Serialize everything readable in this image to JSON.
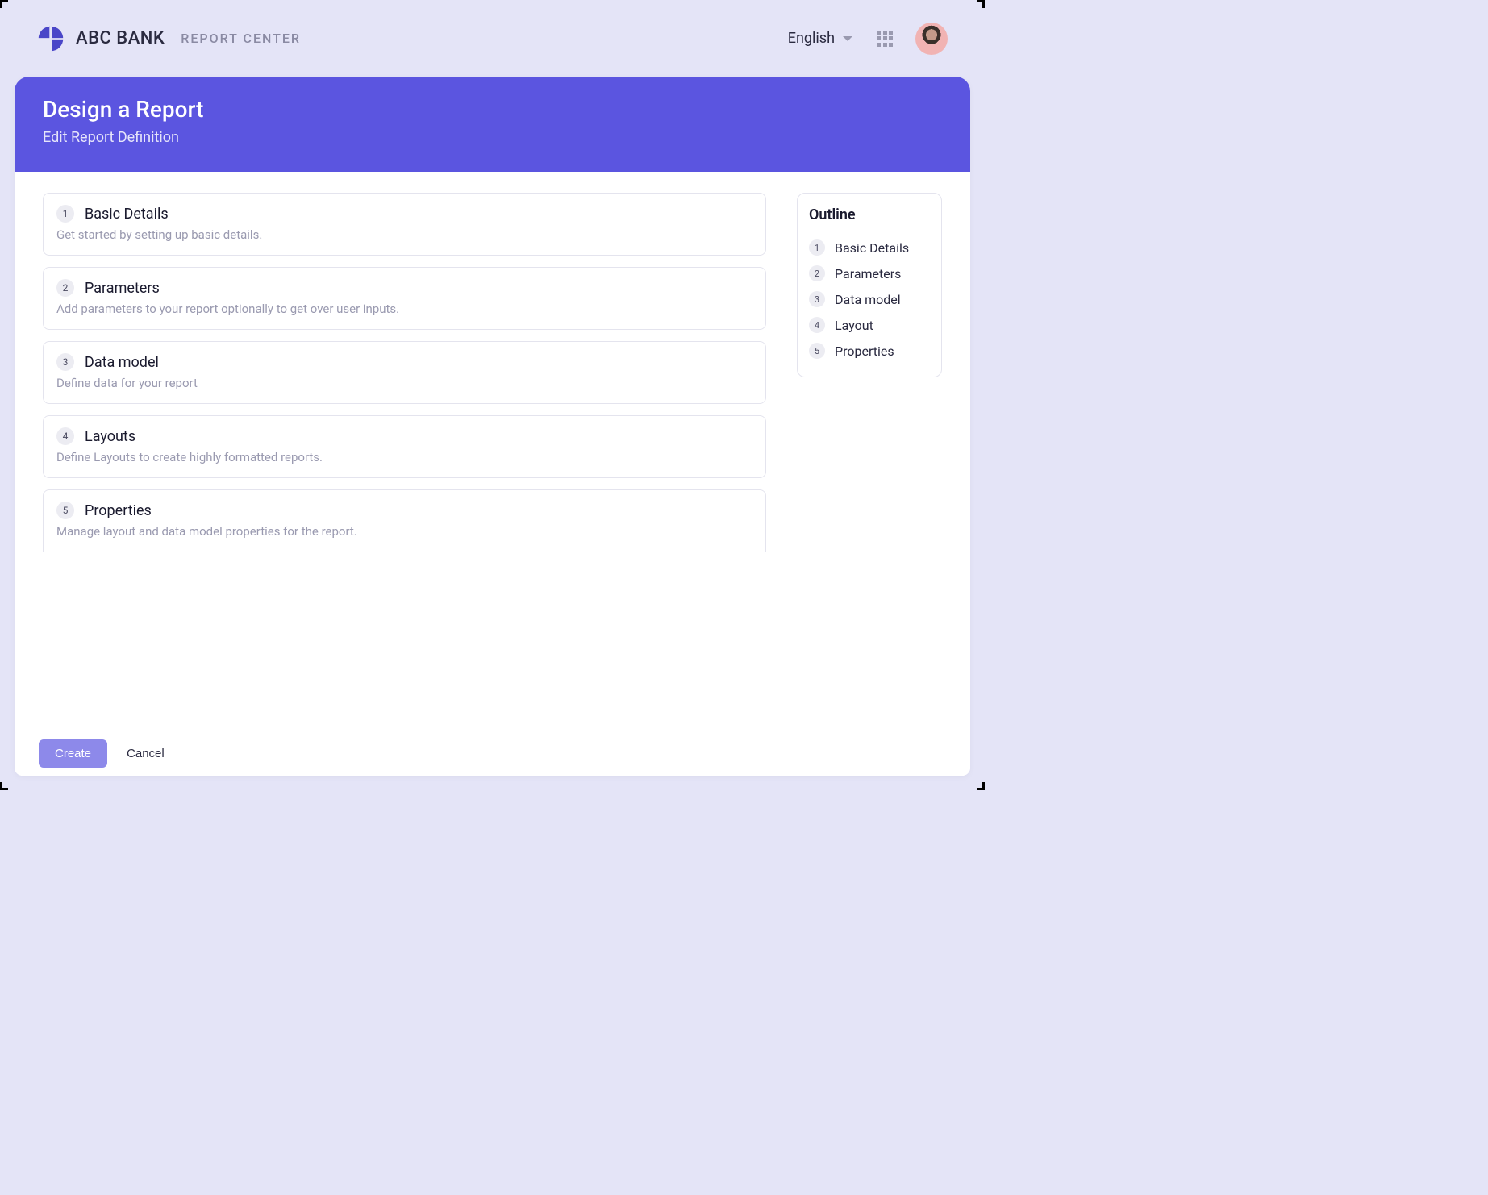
{
  "header": {
    "brand": "ABC BANK",
    "subbrand": "REPORT CENTER",
    "language": "English"
  },
  "hero": {
    "title": "Design a Report",
    "subtitle": "Edit Report Definition"
  },
  "sections": [
    {
      "num": "1",
      "title": "Basic Details",
      "desc": "Get started by setting up basic details."
    },
    {
      "num": "2",
      "title": "Parameters",
      "desc": "Add parameters to your report optionally to get over user inputs."
    },
    {
      "num": "3",
      "title": "Data model",
      "desc": "Define data for your report"
    },
    {
      "num": "4",
      "title": "Layouts",
      "desc": "Define Layouts to create highly formatted reports."
    },
    {
      "num": "5",
      "title": "Properties",
      "desc": "Manage layout and data model properties for the report."
    }
  ],
  "outline": {
    "title": "Outline",
    "items": [
      {
        "num": "1",
        "label": "Basic Details"
      },
      {
        "num": "2",
        "label": "Parameters"
      },
      {
        "num": "3",
        "label": "Data model"
      },
      {
        "num": "4",
        "label": "Layout"
      },
      {
        "num": "5",
        "label": "Properties"
      }
    ]
  },
  "footer": {
    "primary": "Create",
    "secondary": "Cancel"
  }
}
